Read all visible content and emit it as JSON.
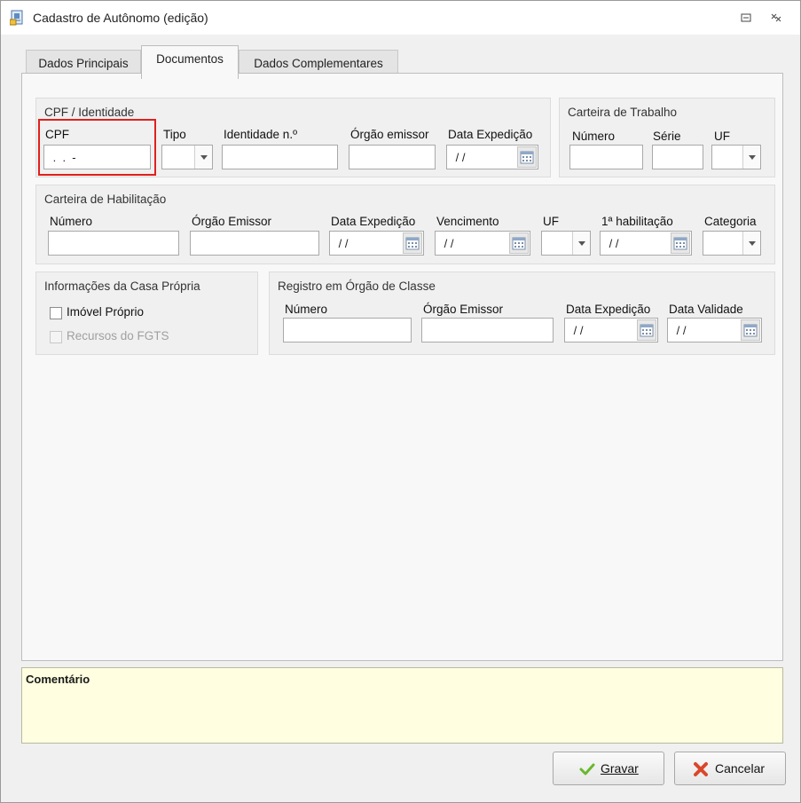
{
  "window": {
    "title": "Cadastro de Autônomo (edição)"
  },
  "tabs": [
    {
      "label": "Dados Principais"
    },
    {
      "label": "Documentos"
    },
    {
      "label": "Dados Complementares"
    }
  ],
  "cpf_group": {
    "title": "CPF / Identidade",
    "cpf_label": "CPF",
    "cpf_value": " .  .  -",
    "tipo_label": "Tipo",
    "identidade_label": "Identidade n.º",
    "orgao_label": "Órgão emissor",
    "data_label": "Data Expedição",
    "data_value": " / /"
  },
  "carteira_trabalho": {
    "title": "Carteira de Trabalho",
    "numero_label": "Número",
    "serie_label": "Série",
    "uf_label": "UF"
  },
  "habilitacao": {
    "title": "Carteira de Habilitação",
    "numero_label": "Número",
    "orgao_label": "Órgão Emissor",
    "data_label": "Data Expedição",
    "data_value": " / /",
    "vencimento_label": "Vencimento",
    "vencimento_value": " / /",
    "uf_label": "UF",
    "primeira_label": "1ª habilitação",
    "primeira_value": " / /",
    "categoria_label": "Categoria"
  },
  "casa_propria": {
    "title": "Informações da Casa Própria",
    "imovel_label": "Imóvel Próprio",
    "fgts_label": "Recursos do FGTS"
  },
  "orgao_classe": {
    "title": "Registro em Órgão de Classe",
    "numero_label": "Número",
    "orgao_label": "Órgão Emissor",
    "data_label": "Data Expedição",
    "data_value": " / /",
    "validade_label": "Data Validade",
    "validade_value": " / /"
  },
  "comment": {
    "label": "Comentário"
  },
  "buttons": {
    "save": "Gravar",
    "cancel": "Cancelar"
  },
  "colors": {
    "highlight": "#e0201e",
    "comment_bg": "#fffee0",
    "check_green": "#6ab82e",
    "cancel_red": "#d9472b"
  }
}
